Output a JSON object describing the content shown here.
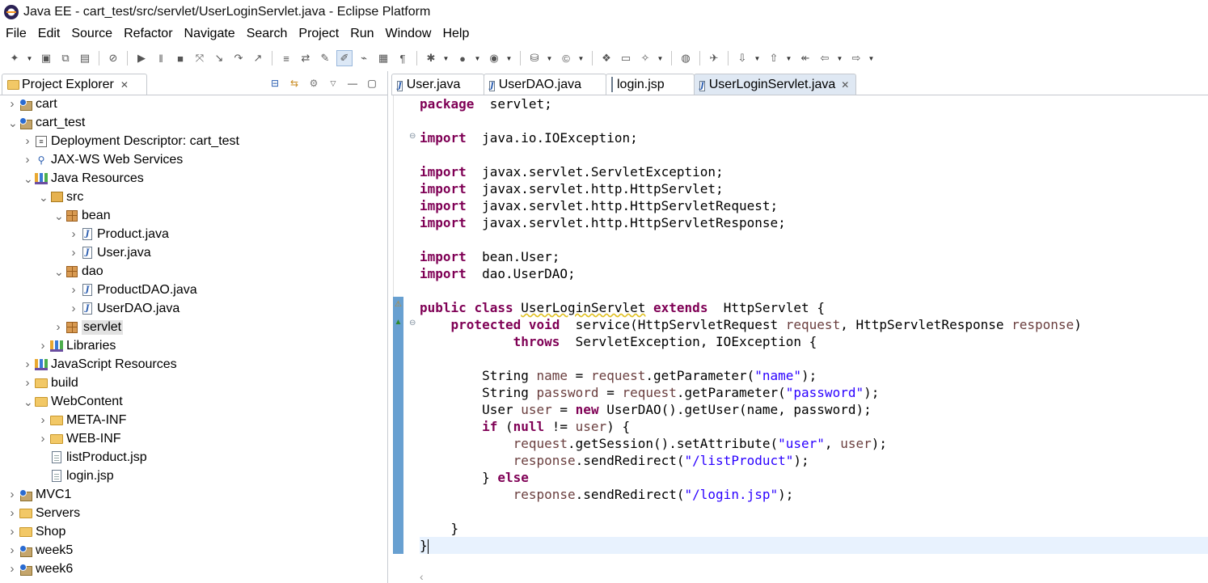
{
  "window": {
    "title": "Java EE - cart_test/src/servlet/UserLoginServlet.java - Eclipse Platform"
  },
  "menu": [
    "File",
    "Edit",
    "Source",
    "Refactor",
    "Navigate",
    "Search",
    "Project",
    "Run",
    "Window",
    "Help"
  ],
  "explorer": {
    "title": "Project Explorer",
    "tree": [
      {
        "label": "cart",
        "depth": 0,
        "arrow": "collapsed",
        "icon": "project-icon"
      },
      {
        "label": "cart_test",
        "depth": 0,
        "arrow": "expanded",
        "icon": "project-icon"
      },
      {
        "label": "Deployment Descriptor: cart_test",
        "depth": 1,
        "arrow": "collapsed",
        "icon": "descriptor-icon"
      },
      {
        "label": "JAX-WS Web Services",
        "depth": 1,
        "arrow": "collapsed",
        "icon": "webservices-icon"
      },
      {
        "label": "Java Resources",
        "depth": 1,
        "arrow": "expanded",
        "icon": "java-resources-icon"
      },
      {
        "label": "src",
        "depth": 2,
        "arrow": "expanded",
        "icon": "source-folder-icon"
      },
      {
        "label": "bean",
        "depth": 3,
        "arrow": "expanded",
        "icon": "package-icon"
      },
      {
        "label": "Product.java",
        "depth": 4,
        "arrow": "collapsed",
        "icon": "java-file-icon"
      },
      {
        "label": "User.java",
        "depth": 4,
        "arrow": "collapsed",
        "icon": "java-file-icon"
      },
      {
        "label": "dao",
        "depth": 3,
        "arrow": "expanded",
        "icon": "package-icon"
      },
      {
        "label": "ProductDAO.java",
        "depth": 4,
        "arrow": "collapsed",
        "icon": "java-file-icon"
      },
      {
        "label": "UserDAO.java",
        "depth": 4,
        "arrow": "collapsed",
        "icon": "java-file-icon"
      },
      {
        "label": "servlet",
        "depth": 3,
        "arrow": "collapsed",
        "icon": "package-icon",
        "selected": true
      },
      {
        "label": "Libraries",
        "depth": 2,
        "arrow": "collapsed",
        "icon": "library-icon"
      },
      {
        "label": "JavaScript Resources",
        "depth": 1,
        "arrow": "collapsed",
        "icon": "library-icon"
      },
      {
        "label": "build",
        "depth": 1,
        "arrow": "collapsed",
        "icon": "folder-icon"
      },
      {
        "label": "WebContent",
        "depth": 1,
        "arrow": "expanded",
        "icon": "folder-icon"
      },
      {
        "label": "META-INF",
        "depth": 2,
        "arrow": "collapsed",
        "icon": "folder-icon"
      },
      {
        "label": "WEB-INF",
        "depth": 2,
        "arrow": "collapsed",
        "icon": "folder-icon"
      },
      {
        "label": "listProduct.jsp",
        "depth": 2,
        "arrow": "none",
        "icon": "jsp-file-icon"
      },
      {
        "label": "login.jsp",
        "depth": 2,
        "arrow": "none",
        "icon": "jsp-file-icon"
      },
      {
        "label": "MVC1",
        "depth": 0,
        "arrow": "collapsed",
        "icon": "project-icon"
      },
      {
        "label": "Servers",
        "depth": 0,
        "arrow": "collapsed",
        "icon": "folder-icon"
      },
      {
        "label": "Shop",
        "depth": 0,
        "arrow": "collapsed",
        "icon": "folder-icon"
      },
      {
        "label": "week5",
        "depth": 0,
        "arrow": "collapsed",
        "icon": "project-icon"
      },
      {
        "label": "week6",
        "depth": 0,
        "arrow": "collapsed",
        "icon": "project-icon"
      }
    ]
  },
  "editor": {
    "tabs": [
      {
        "label": "User.java",
        "icon": "java-file-icon",
        "active": false
      },
      {
        "label": "UserDAO.java",
        "icon": "java-file-icon",
        "active": false
      },
      {
        "label": "login.jsp",
        "icon": "jsp-file-icon",
        "active": false
      },
      {
        "label": "UserLoginServlet.java",
        "icon": "java-file-icon",
        "active": true
      }
    ],
    "code_lines": [
      [
        [
          "kw",
          "package"
        ],
        [
          "",
          "  servlet;"
        ]
      ],
      [],
      [
        [
          "kw",
          "import"
        ],
        [
          "",
          "  java.io.IOException;"
        ]
      ],
      [],
      [
        [
          "kw",
          "import"
        ],
        [
          "",
          "  javax.servlet.ServletException;"
        ]
      ],
      [
        [
          "kw",
          "import"
        ],
        [
          "",
          "  javax.servlet.http.HttpServlet;"
        ]
      ],
      [
        [
          "kw",
          "import"
        ],
        [
          "",
          "  javax.servlet.http.HttpServletRequest;"
        ]
      ],
      [
        [
          "kw",
          "import"
        ],
        [
          "",
          "  javax.servlet.http.HttpServletResponse;"
        ]
      ],
      [],
      [
        [
          "kw",
          "import"
        ],
        [
          "",
          "  bean.User;"
        ]
      ],
      [
        [
          "kw",
          "import"
        ],
        [
          "",
          "  dao.UserDAO;"
        ]
      ],
      [],
      [
        [
          "kw",
          "public"
        ],
        [
          "",
          " "
        ],
        [
          "kw",
          "class"
        ],
        [
          "",
          " "
        ],
        [
          "warn",
          "UserLoginServlet"
        ],
        [
          "",
          " "
        ],
        [
          "kw",
          "extends"
        ],
        [
          "",
          "  HttpServlet {"
        ]
      ],
      [
        [
          "",
          "    "
        ],
        [
          "kw",
          "protected"
        ],
        [
          "",
          " "
        ],
        [
          "kw",
          "void"
        ],
        [
          "",
          "  service(HttpServletRequest "
        ],
        [
          "prm",
          "request"
        ],
        [
          "",
          ", HttpServletResponse "
        ],
        [
          "prm",
          "response"
        ],
        [
          "",
          ")"
        ]
      ],
      [
        [
          "",
          "            "
        ],
        [
          "kw",
          "throws"
        ],
        [
          "",
          "  ServletException, IOException {"
        ]
      ],
      [],
      [
        [
          "",
          "        String "
        ],
        [
          "var",
          "name"
        ],
        [
          "",
          " = "
        ],
        [
          "prm",
          "request"
        ],
        [
          "",
          ".getParameter("
        ],
        [
          "str",
          "\"name\""
        ],
        [
          "",
          ");"
        ]
      ],
      [
        [
          "",
          "        String "
        ],
        [
          "var",
          "password"
        ],
        [
          "",
          " = "
        ],
        [
          "prm",
          "request"
        ],
        [
          "",
          ".getParameter("
        ],
        [
          "str",
          "\"password\""
        ],
        [
          "",
          ");"
        ]
      ],
      [
        [
          "",
          "        User "
        ],
        [
          "var",
          "user"
        ],
        [
          "",
          " = "
        ],
        [
          "kw",
          "new"
        ],
        [
          "",
          " UserDAO().getUser(name, password);"
        ]
      ],
      [
        [
          "",
          "        "
        ],
        [
          "kw",
          "if"
        ],
        [
          "",
          " ("
        ],
        [
          "kw",
          "null"
        ],
        [
          "",
          " != "
        ],
        [
          "var",
          "user"
        ],
        [
          "",
          ") {"
        ]
      ],
      [
        [
          "",
          "            "
        ],
        [
          "prm",
          "request"
        ],
        [
          "",
          ".getSession().setAttribute("
        ],
        [
          "str",
          "\"user\""
        ],
        [
          "",
          ", "
        ],
        [
          "var",
          "user"
        ],
        [
          "",
          ");"
        ]
      ],
      [
        [
          "",
          "            "
        ],
        [
          "prm",
          "response"
        ],
        [
          "",
          ".sendRedirect("
        ],
        [
          "str",
          "\"/listProduct\""
        ],
        [
          "",
          ");"
        ]
      ],
      [
        [
          "",
          "        } "
        ],
        [
          "kw",
          "else"
        ]
      ],
      [
        [
          "",
          "            "
        ],
        [
          "prm",
          "response"
        ],
        [
          "",
          ".sendRedirect("
        ],
        [
          "str",
          "\"/login.jsp\""
        ],
        [
          "",
          ");"
        ]
      ],
      [],
      [
        [
          "",
          "    }"
        ]
      ],
      [
        [
          "",
          "}"
        ]
      ]
    ],
    "cursor_line": 27
  }
}
